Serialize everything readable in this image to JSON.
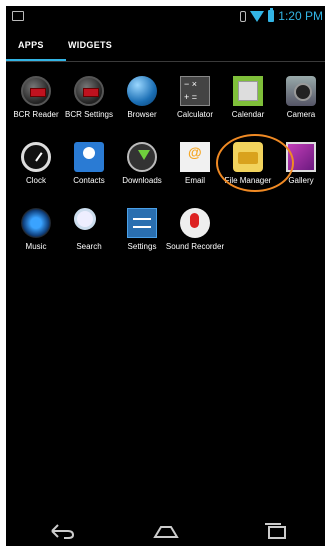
{
  "status_bar": {
    "time": "1:20 PM",
    "left_icons": [
      "image-icon",
      "grid-icon",
      "cloud-icon"
    ],
    "right_icons": [
      "vibrate-icon",
      "wifi-icon",
      "battery-icon"
    ]
  },
  "tabs": [
    {
      "label": "APPS",
      "active": true
    },
    {
      "label": "WIDGETS",
      "active": false
    }
  ],
  "apps": [
    {
      "label": "BCR Reader",
      "icon": "bcr-reader-icon"
    },
    {
      "label": "BCR Settings",
      "icon": "bcr-settings-icon"
    },
    {
      "label": "Browser",
      "icon": "browser-icon"
    },
    {
      "label": "Calculator",
      "icon": "calculator-icon"
    },
    {
      "label": "Calendar",
      "icon": "calendar-icon"
    },
    {
      "label": "Camera",
      "icon": "camera-icon"
    },
    {
      "label": "Clock",
      "icon": "clock-icon"
    },
    {
      "label": "Contacts",
      "icon": "contacts-icon"
    },
    {
      "label": "Downloads",
      "icon": "downloads-icon"
    },
    {
      "label": "Email",
      "icon": "email-icon"
    },
    {
      "label": "File Manager",
      "icon": "file-manager-icon"
    },
    {
      "label": "Gallery",
      "icon": "gallery-icon"
    },
    {
      "label": "Music",
      "icon": "music-icon"
    },
    {
      "label": "Search",
      "icon": "search-icon"
    },
    {
      "label": "Settings",
      "icon": "settings-icon"
    },
    {
      "label": "Sound Recorder",
      "icon": "sound-recorder-icon"
    }
  ],
  "nav_bar": [
    "back-icon",
    "home-icon",
    "recent-apps-icon"
  ],
  "colors": {
    "accent": "#33b5e5",
    "highlight": "#f08a24",
    "background": "#000000"
  }
}
